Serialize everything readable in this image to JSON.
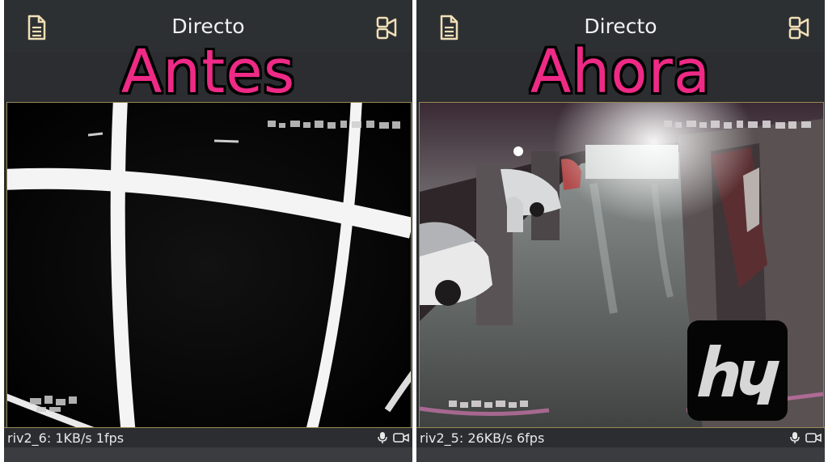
{
  "panels": {
    "left": {
      "header_title": "Directo",
      "overlay_label": "Antes",
      "stream_status": "riv2_6: 1KB/s 1fps"
    },
    "right": {
      "header_title": "Directo",
      "overlay_label": "Ahora",
      "stream_status": "riv2_5: 26KB/s 6fps"
    }
  },
  "icons": {
    "header_left": "document-icon",
    "header_right": "video-camera-icon",
    "status_mic": "microphone-icon",
    "status_cam": "camera-icon"
  },
  "colors": {
    "overlay_text": "#ee2a86",
    "panel_bg": "#2b2d30",
    "video_border": "#9a8a55"
  }
}
